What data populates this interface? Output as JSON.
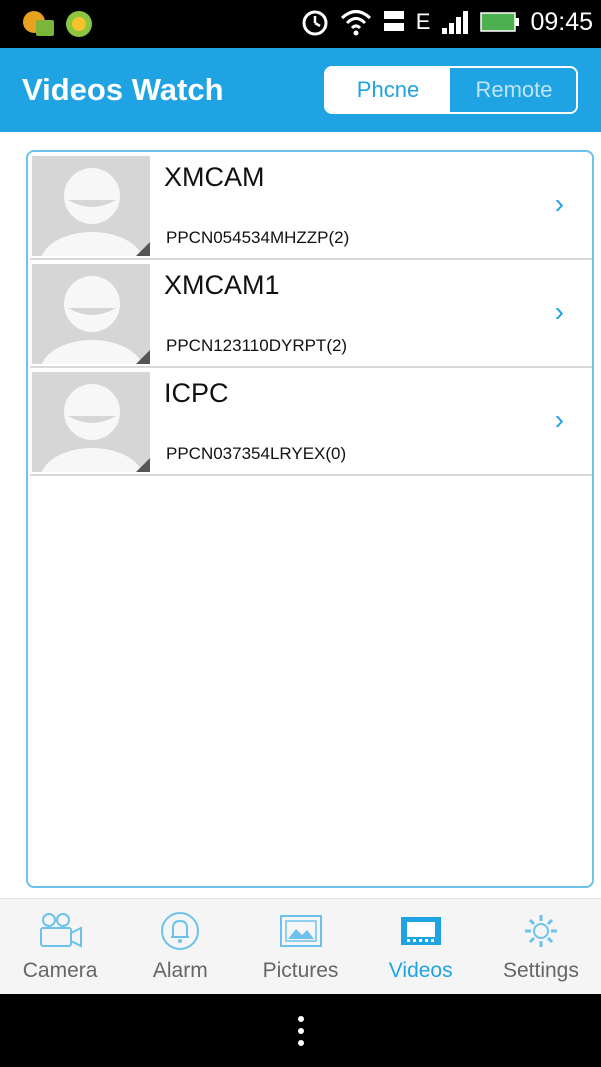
{
  "status_bar": {
    "time": "09:45",
    "network": "E",
    "icons": [
      "app-notification-icon",
      "app-notification-icon-2",
      "alarm-clock-icon",
      "wifi-icon",
      "data-icon",
      "signal-icon",
      "battery-icon"
    ]
  },
  "header": {
    "title": "Videos Watch",
    "segments": [
      {
        "label": "Phcne",
        "active": true
      },
      {
        "label": "Remote",
        "active": false
      }
    ]
  },
  "devices": [
    {
      "name": "XMCAM",
      "id": "PPCN054534MHZZP(2)"
    },
    {
      "name": "XMCAM1",
      "id": "PPCN123110DYRPT(2)"
    },
    {
      "name": "ICPC",
      "id": "PPCN037354LRYEX(0)"
    }
  ],
  "nav": {
    "items": [
      {
        "label": "Camera",
        "icon": "camera-icon"
      },
      {
        "label": "Alarm",
        "icon": "bell-icon"
      },
      {
        "label": "Pictures",
        "icon": "picture-icon"
      },
      {
        "label": "Videos",
        "icon": "film-icon"
      },
      {
        "label": "Settings",
        "icon": "gear-icon"
      }
    ],
    "active": "Videos"
  },
  "colors": {
    "accent": "#1fa3e3",
    "nav_inactive": "#666666",
    "status_bar": "#000000"
  }
}
